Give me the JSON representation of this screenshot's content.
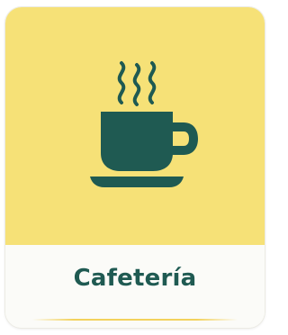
{
  "card": {
    "label": "Cafetería",
    "icon": "coffee-cup-icon",
    "colors": {
      "panel": "#f6e177",
      "icon": "#1f5a52",
      "label": "#1f5a52",
      "footer": "#fbfbf8"
    }
  }
}
